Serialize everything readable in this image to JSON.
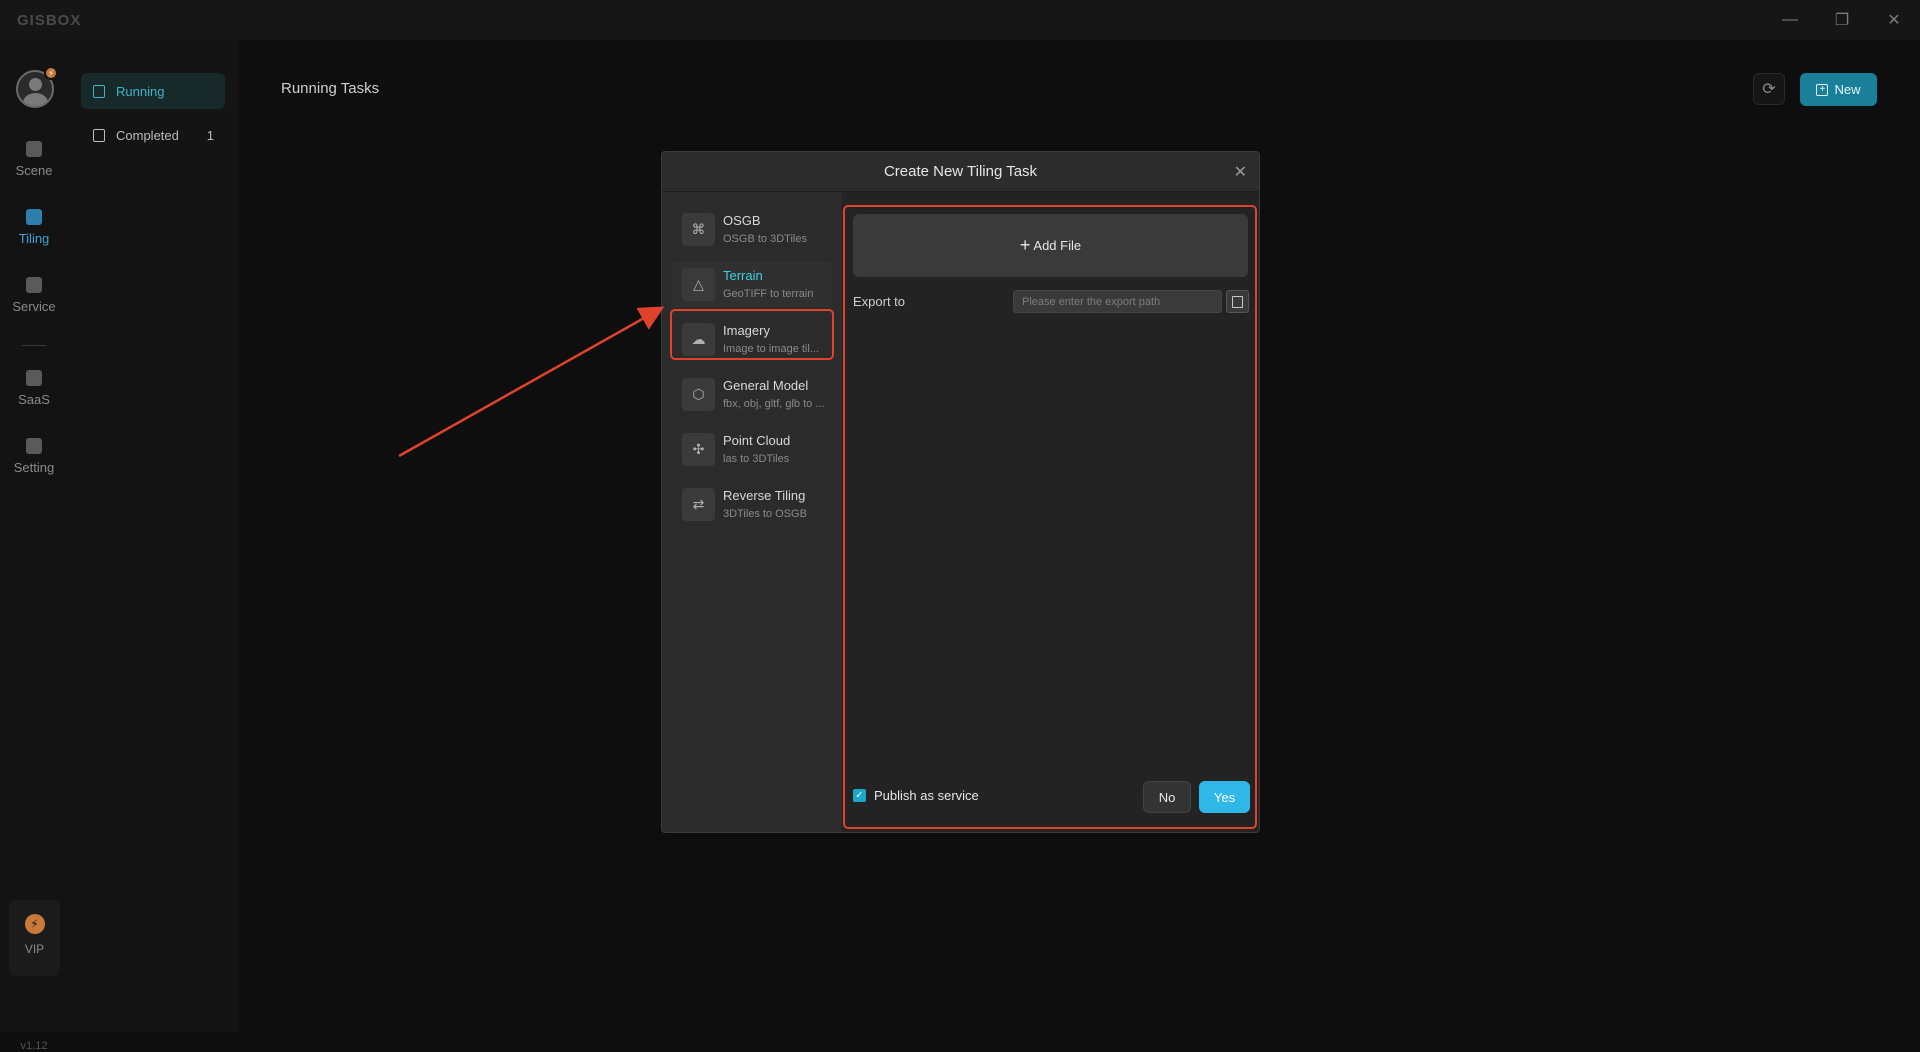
{
  "app": {
    "logo": "GISBOX",
    "version": "v1.12"
  },
  "window_controls": {
    "minimize": "—",
    "restore": "❐",
    "close": "✕"
  },
  "rail": {
    "items": [
      {
        "label": "Scene"
      },
      {
        "label": "Tiling"
      },
      {
        "label": "Service"
      },
      {
        "label": "SaaS"
      },
      {
        "label": "Setting"
      }
    ],
    "active": "Tiling",
    "vip_label": "VIP",
    "vip_icon": "⚡",
    "avatar_badge": "⚡"
  },
  "subnav": {
    "items": [
      {
        "label": "Running"
      },
      {
        "label": "Completed",
        "count": "1"
      }
    ],
    "active": "Running"
  },
  "main": {
    "title": "Running Tasks",
    "refresh_icon": "⟳",
    "new_label": "New",
    "new_icon": "+"
  },
  "modal": {
    "title": "Create New Tiling Task",
    "close_icon": "✕",
    "task_types": [
      {
        "name": "OSGB",
        "desc": "OSGB to 3DTiles",
        "icon": "⌘"
      },
      {
        "name": "Terrain",
        "desc": "GeoTIFF to terrain",
        "icon": "△"
      },
      {
        "name": "Imagery",
        "desc": "Image to image til...",
        "icon": "☁"
      },
      {
        "name": "General Model",
        "desc": "fbx, obj, gltf, glb to ...",
        "icon": "⬡"
      },
      {
        "name": "Point Cloud",
        "desc": "las to 3DTiles",
        "icon": "✣"
      },
      {
        "name": "Reverse Tiling",
        "desc": "3DTiles to OSGB",
        "icon": "⇄"
      }
    ],
    "selected": "Terrain",
    "add_file_label": "Add File",
    "add_file_icon": "+",
    "export_label": "Export to",
    "export_placeholder": "Please enter the export path",
    "export_value": "",
    "publish_label": "Publish as service",
    "publish_checked": true,
    "checkbox_mark": "✓",
    "no_label": "No",
    "yes_label": "Yes"
  },
  "colors": {
    "accent": "#2fb7e8",
    "teal": "#3fd0e0",
    "highlight": "#e0432c",
    "vip": "#c97a3a"
  }
}
